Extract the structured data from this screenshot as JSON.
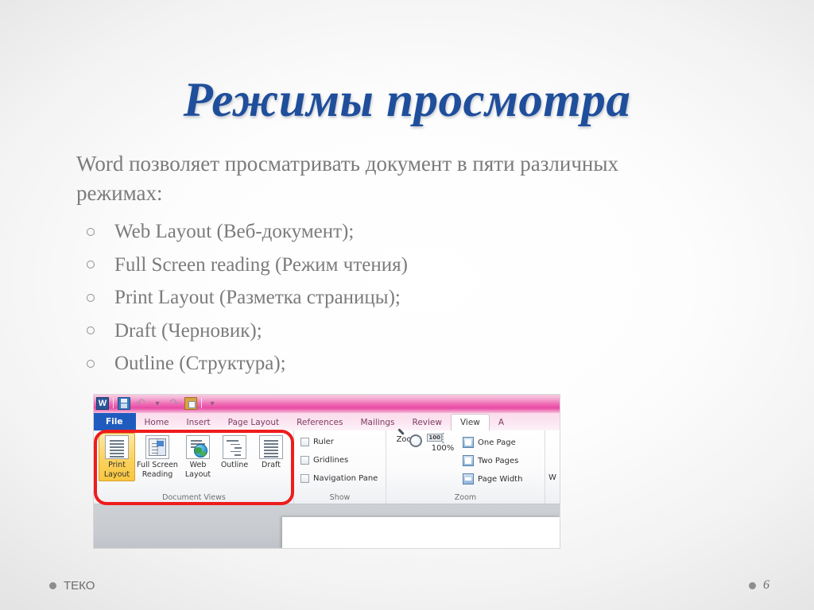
{
  "slide": {
    "title": "Режимы просмотра",
    "intro": "Word позволяет просматривать документ в пяти различных режимах:",
    "bullets": [
      "Web Layout (Веб-документ);",
      "Full Screen reading (Режим чтения)",
      "Print Layout (Разметка страницы);",
      "Draft (Черновик);",
      "Outline (Структура);"
    ]
  },
  "colors": {
    "title_blue": "#1f4e9b",
    "body_gray": "#7b7b7b",
    "callout_red": "#ee1c1c",
    "selected_yellow": "#fcd462",
    "titlebar_pink": "#ef6cb4",
    "file_tab_blue": "#1f5bbf"
  },
  "screenshot": {
    "app": "Microsoft Word 2010 — View ribbon",
    "quick_access": [
      {
        "name": "word-icon",
        "label": "W"
      },
      {
        "name": "save-icon",
        "label": ""
      },
      {
        "name": "undo-icon",
        "label": "↶"
      },
      {
        "name": "undo-dropdown-icon",
        "label": "▾"
      },
      {
        "name": "redo-icon",
        "label": "↷"
      },
      {
        "name": "paste-icon",
        "label": ""
      },
      {
        "name": "customize-qat-icon",
        "label": "▾"
      }
    ],
    "tabs": [
      {
        "label": "File",
        "state": "file"
      },
      {
        "label": "Home",
        "state": "normal"
      },
      {
        "label": "Insert",
        "state": "normal"
      },
      {
        "label": "Page Layout",
        "state": "normal"
      },
      {
        "label": "References",
        "state": "normal"
      },
      {
        "label": "Mailings",
        "state": "normal"
      },
      {
        "label": "Review",
        "state": "normal"
      },
      {
        "label": "View",
        "state": "active"
      },
      {
        "label": "A",
        "state": "cut"
      }
    ],
    "groups": {
      "document_views": {
        "label": "Document Views",
        "buttons": [
          {
            "label": "Print Layout",
            "line1": "Print",
            "line2": "Layout",
            "icon": "print-layout-icon",
            "selected": true
          },
          {
            "label": "Full Screen Reading",
            "line1": "Full Screen",
            "line2": "Reading",
            "icon": "full-screen-reading-icon",
            "selected": false
          },
          {
            "label": "Web Layout",
            "line1": "Web",
            "line2": "Layout",
            "icon": "web-layout-icon",
            "selected": false
          },
          {
            "label": "Outline",
            "line1": "Outline",
            "line2": "",
            "icon": "outline-view-icon",
            "selected": false
          },
          {
            "label": "Draft",
            "line1": "Draft",
            "line2": "",
            "icon": "draft-view-icon",
            "selected": false
          }
        ]
      },
      "show": {
        "label": "Show",
        "checkboxes": [
          {
            "label": "Ruler",
            "checked": false
          },
          {
            "label": "Gridlines",
            "checked": false
          },
          {
            "label": "Navigation Pane",
            "checked": false
          }
        ]
      },
      "zoom": {
        "label": "Zoom",
        "buttons": [
          {
            "label": "Zoom",
            "icon": "magnifier-icon"
          },
          {
            "label": "100%",
            "icon": "zoom-100-icon",
            "badge": "100"
          }
        ],
        "page_options": [
          {
            "label": "One Page",
            "icon": "one-page-icon"
          },
          {
            "label": "Two Pages",
            "icon": "two-pages-icon"
          },
          {
            "label": "Page Width",
            "icon": "page-width-icon"
          }
        ]
      },
      "cut_off": {
        "label": "W"
      }
    },
    "callout": {
      "shape": "rounded-rectangle",
      "target": "Document Views"
    }
  },
  "footer": {
    "left_label": "ТЕКО",
    "page_number": "6"
  }
}
